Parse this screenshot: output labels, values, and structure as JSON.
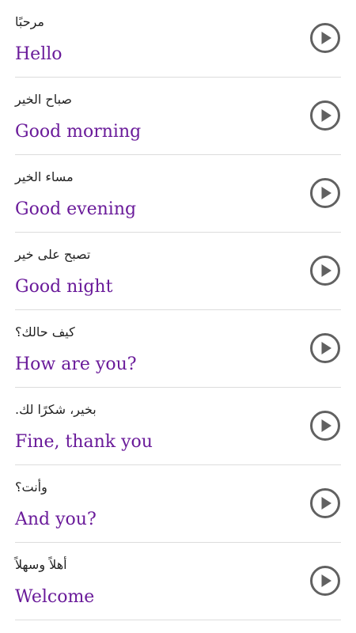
{
  "phrases": [
    {
      "native": "مرحبًا",
      "english": "Hello",
      "icon": "play-circle-icon"
    },
    {
      "native": "صباح الخير",
      "english": "Good morning",
      "icon": "play-circle-icon"
    },
    {
      "native": "مساء الخير",
      "english": "Good evening",
      "icon": "play-circle-icon"
    },
    {
      "native": "تصبح على خير",
      "english": "Good night",
      "icon": "play-circle-icon"
    },
    {
      "native": "كيف حالك؟",
      "english": "How are you?",
      "icon": "play-circle-icon"
    },
    {
      "native": "بخير، شكرًا لك.",
      "english": "Fine, thank you",
      "icon": "play-circle-icon"
    },
    {
      "native": "وأنت؟",
      "english": "And you?",
      "icon": "play-circle-icon"
    },
    {
      "native": "أهلاً وسهلاً",
      "english": "Welcome",
      "icon": "play-circle-icon"
    }
  ],
  "colors": {
    "english_text": "#6a1b9a",
    "native_text": "#222222",
    "icon": "#616161",
    "divider": "#dcdcdc"
  }
}
